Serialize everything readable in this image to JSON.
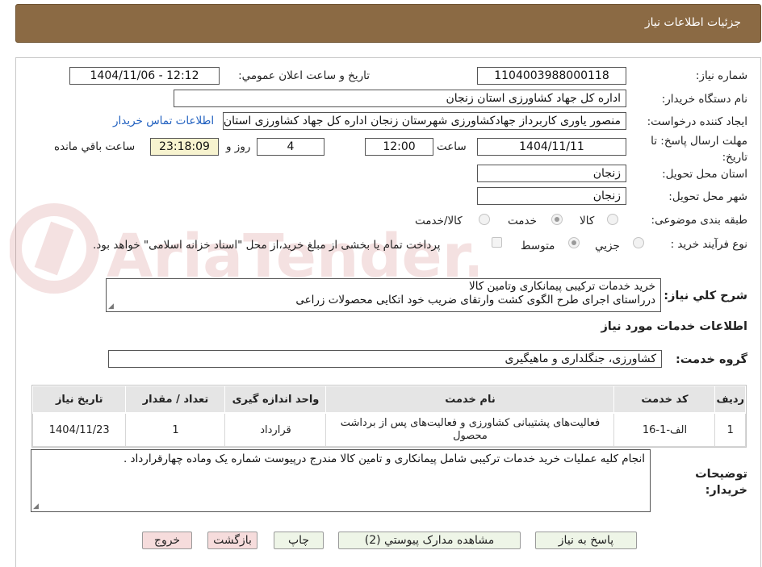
{
  "header": {
    "title": "جزئیات اطلاعات نیاز"
  },
  "form": {
    "need_number_label": "شماره نیاز:",
    "need_number": "1104003988000118",
    "announce_label": "تاریخ و ساعت اعلان عمومي:",
    "announce_value": "1404/11/06 - 12:12",
    "buyer_label": "نام دستگاه خریدار:",
    "buyer_value": "اداره کل جهاد کشاورزی استان زنجان",
    "creator_label": "ایجاد کننده درخواست:",
    "creator_value": "منصور یاوری کاربرداز جهادکشاورزی شهرستان زنجان اداره کل جهاد کشاورزی استان زنجان",
    "contact_link": "اطلاعات تماس خریدار",
    "deadline_label": "مهلت ارسال پاسخ: تا تاریخ:",
    "deadline_date": "1404/11/11",
    "time_label": "ساعت",
    "deadline_time": "12:00",
    "days_value": "4",
    "days_label": "روز و",
    "remaining_time": "23:18:09",
    "remaining_label": "ساعت باقي مانده",
    "province_label": "استان محل تحویل:",
    "province_value": "زنجان",
    "city_label": "شهر محل تحویل:",
    "city_value": "زنجان",
    "category_label": "طبقه بندی موضوعی:",
    "category_options": [
      {
        "label": "کالا",
        "selected": false
      },
      {
        "label": "خدمت",
        "selected": true
      },
      {
        "label": "کالا/خدمت",
        "selected": false
      }
    ],
    "process_label": "نوع فرآیند خرید :",
    "process_options": [
      {
        "label": "جزيي",
        "selected": false
      },
      {
        "label": "متوسط",
        "selected": true
      }
    ],
    "payment_note": "پرداخت تمام یا بخشی از مبلغ خرید،از محل \"اسناد خزانه اسلامی\" خواهد بود.",
    "summary_label": "شرح کلي نیاز:",
    "summary_line1": "خرید خدمات ترکیبی پیمانکاری وتامین کالا",
    "summary_line2": "درراستای اجرای طرح الگوی کشت وارتقای ضریب خود اتکایی محصولات زراعی"
  },
  "services": {
    "section_title": "اطلاعات خدمات مورد نیاز",
    "group_label": "گروه خدمت:",
    "group_value": "کشاورزی، جنگلداری و ماهیگیری",
    "columns": [
      "ردیف",
      "کد خدمت",
      "نام خدمت",
      "واحد اندازه گیری",
      "تعداد / مقدار",
      "تاریخ نیاز"
    ],
    "rows": [
      {
        "row": "1",
        "code": "الف-1-16",
        "name": "فعالیت‌های پشتیبانی کشاورزی و فعالیت‌های پس از برداشت محصول",
        "unit": "قرارداد",
        "qty": "1",
        "date": "1404/11/23"
      }
    ]
  },
  "buyer_notes": {
    "label": "توضیحات خریدار:",
    "text": "انجام کلیه عملیات خرید خدمات ترکیبی شامل پیمانکاری و تامین کالا مندرج درپیوست شماره یک وماده چهارقرارداد ."
  },
  "buttons": {
    "reply": "پاسخ به نیاز",
    "attachments": "مشاهده مدارک پیوستي (2)",
    "print": "چاپ",
    "back": "بازگشت",
    "exit": "خروج"
  },
  "watermark": {
    "text": "AriaTender.neT"
  },
  "colors": {
    "header_bg": "#8b6a44",
    "highlight": "#f7f3cf",
    "link": "#1f5fbf",
    "button_green": "#eef5e7",
    "button_pink": "#f6dcdc"
  }
}
